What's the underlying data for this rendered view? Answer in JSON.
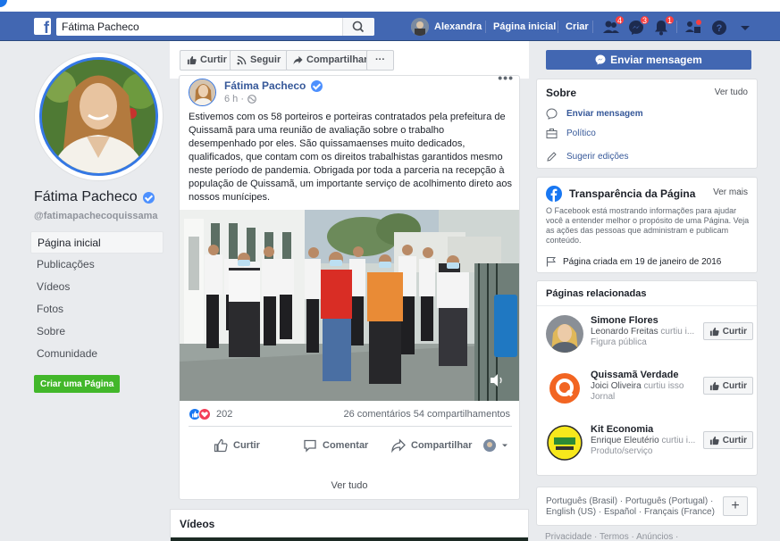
{
  "colors": {
    "facebook_blue": "#4267b2",
    "link_blue": "#365899",
    "create_page_green": "#42b72a",
    "notification_red": "#fa3e3e",
    "background": "#e9ebee"
  },
  "navbar": {
    "logo": "f",
    "search_value": "Fátima Pacheco",
    "user_name": "Alexandra",
    "home_label": "Página inicial",
    "create_label": "Criar",
    "friends_badge": "4",
    "messages_badge": "3",
    "notifications_badge": "1",
    "icons": [
      "search-icon",
      "friends-icon",
      "messenger-icon",
      "notifications-icon",
      "quick-help-icon",
      "help-icon",
      "chevron-down-icon"
    ]
  },
  "page": {
    "name": "Fátima Pacheco",
    "handle": "@fatimapachecoquissama",
    "menu": [
      "Página inicial",
      "Publicações",
      "Vídeos",
      "Fotos",
      "Sobre",
      "Comunidade"
    ],
    "create_page_label": "Criar uma Página"
  },
  "actions": {
    "like": "Curtir",
    "follow": "Seguir",
    "share": "Compartilhar",
    "more": "···",
    "send_message": "Enviar mensagem"
  },
  "post": {
    "author": "Fátima Pacheco",
    "time": "6 h ·",
    "text": "Estivemos com os 58 porteiros e porteiras contratados pela prefeitura de Quissamã para uma reunião de avaliação sobre o trabalho desempenhado por eles. São quissamaenses muito dedicados, qualificados, que contam com os direitos trabalhistas garantidos mesmo neste período de pandemia. Obrigada por toda a parceria na recepção à população de Quissamã, um importante serviço de acolhimento direto aos nossos munícipes.",
    "reactions_count": "202",
    "comments": "26 comentários",
    "shares": "54 compartilhamentos",
    "like_label": "Curtir",
    "comment_label": "Comentar",
    "share_label": "Compartilhar",
    "view_all": "Ver tudo"
  },
  "videos": {
    "title": "Vídeos"
  },
  "about": {
    "title": "Sobre",
    "see_all": "Ver tudo",
    "items": [
      "Enviar mensagem",
      "Político",
      "Sugerir edições"
    ]
  },
  "transparency": {
    "title": "Transparência da Página",
    "see_more": "Ver mais",
    "text": "O Facebook está mostrando informações para ajudar você a entender melhor o propósito de uma Página. Veja as ações das pessoas que administram e publicam conteúdo.",
    "created": "Página criada em 19 de janeiro de 2016"
  },
  "related": {
    "title": "Páginas relacionadas",
    "like_label": "Curtir",
    "pages": [
      {
        "name": "Simone Flores",
        "liker": "Leonardo Freitas",
        "liked_text": " curtiu i...",
        "category": "Figura pública"
      },
      {
        "name": "Quissamã Verdade",
        "liker": "Joici Oliveira",
        "liked_text": " curtiu isso",
        "category": "Jornal"
      },
      {
        "name": "Kit Economia",
        "liker": "Enrique Eleutério",
        "liked_text": " curtiu i...",
        "category": "Produto/serviço"
      }
    ]
  },
  "languages": {
    "line1": "Português (Brasil) · Português (Portugal) ·",
    "line2": "English (US) · Español · Français (France)",
    "plus": "+"
  },
  "footer": {
    "text": "Privacidade · Termos · Anúncios ·"
  }
}
